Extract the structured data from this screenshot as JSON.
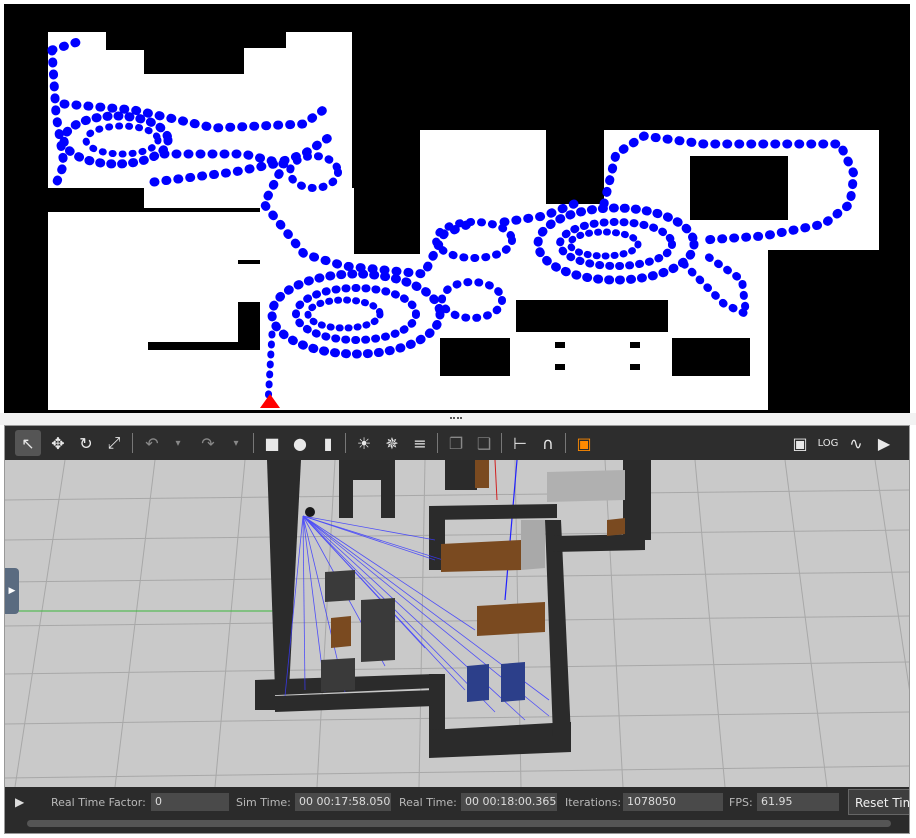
{
  "map_panel": {
    "name": "occupancy-map-with-path"
  },
  "toolbar": {
    "icons": [
      "select-arrow-icon",
      "translate-icon",
      "rotate-icon",
      "scale-icon",
      "undo-icon",
      "undo-dropdown-icon",
      "redo-icon",
      "redo-dropdown-icon",
      "box-icon",
      "sphere-icon",
      "cylinder-icon",
      "point-light-icon",
      "spot-light-icon",
      "directional-light-icon",
      "copy-icon",
      "paste-icon",
      "align-icon",
      "snap-magnet-icon",
      "view-angle-icon",
      "screenshot-icon",
      "log-icon",
      "plot-icon",
      "record-video-icon"
    ]
  },
  "status": {
    "real_time_factor_label": "Real Time Factor:",
    "real_time_factor_value": "0",
    "sim_time_label": "Sim Time:",
    "sim_time_value": "00 00:17:58.050",
    "real_time_label": "Real Time:",
    "real_time_value": "00 00:18:00.365",
    "iterations_label": "Iterations:",
    "iterations_value": "1078050",
    "fps_label": "FPS:",
    "fps_value": "61.95",
    "reset_label": "Reset Time"
  },
  "colors": {
    "path": "#0000ff",
    "robot_marker": "#ff0000",
    "toolbar_bg": "#2d2d2d",
    "floor": "#c8c8c8",
    "walls": "#2b2b2b",
    "furniture": "#7a4a20",
    "laser": "#3a3aff"
  }
}
